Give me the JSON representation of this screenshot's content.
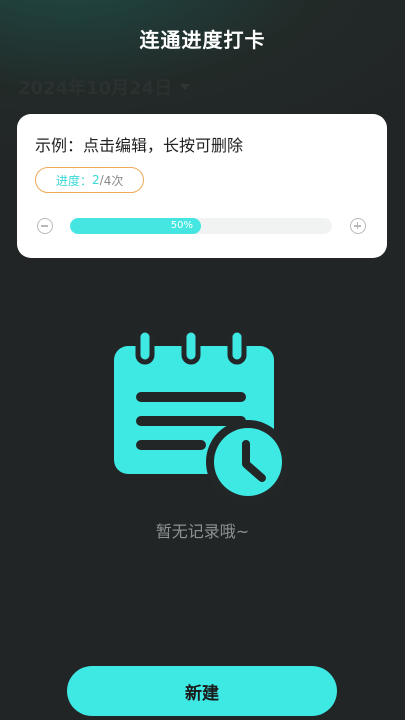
{
  "header": {
    "title": "连通进度打卡"
  },
  "date_picker": {
    "value": "2024年10月24日",
    "caret_icon": "caret-down-icon"
  },
  "card": {
    "title": "示例：点击编辑，长按可删除",
    "progress_label": "进度：",
    "progress_done": "2",
    "progress_sep": "/",
    "progress_total": "4次",
    "percent_text": "50%",
    "percent_value": 0.5,
    "decrement_icon": "minus-circle-icon",
    "increment_icon": "plus-circle-icon"
  },
  "empty_state": {
    "icon": "notepad-clock-icon",
    "text": "暂无记录哦~"
  },
  "actions": {
    "new_label": "新建"
  },
  "colors": {
    "accent": "#3ee8e3",
    "pill_border": "#f0a85a",
    "background": "#232627"
  }
}
